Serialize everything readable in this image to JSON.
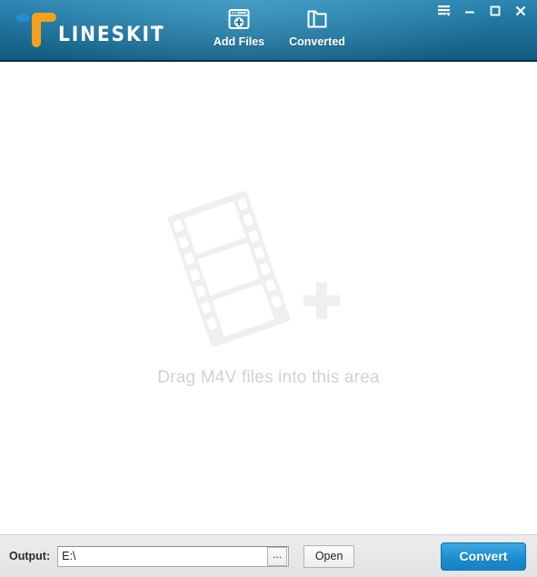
{
  "window": {
    "title": "LINESKIT",
    "controls": [
      {
        "name": "menu",
        "icon": "menu-lines-arrow-icon",
        "label": ""
      },
      {
        "name": "minimize",
        "icon": "minimize-icon",
        "label": ""
      },
      {
        "name": "maximize",
        "icon": "maximize-icon",
        "label": ""
      },
      {
        "name": "close",
        "icon": "close-icon",
        "label": ""
      }
    ]
  },
  "header": {
    "logo_text": "LINESKIT",
    "logo_mark_color": "#f5a01b",
    "logo_dot_color": "#1e8fd6",
    "background_top": "#2b86b2",
    "background_bottom": "#125a81",
    "toolbar": [
      {
        "id": "add-files",
        "label": "Add Files",
        "icon": "window-plus-icon"
      },
      {
        "id": "converted",
        "label": "Converted",
        "icon": "folder-icon"
      }
    ]
  },
  "main": {
    "drop_text": "Drag M4V files into this area",
    "drop_text_color": "#cfd2d4",
    "placeholder_graphic": "film-strip-plus-icon",
    "placeholder_graphic_color": "#efefef"
  },
  "footer": {
    "output_label": "Output:",
    "output_value": "E:\\",
    "output_placeholder": "",
    "browse_label": "...",
    "open_label": "Open",
    "convert_label": "Convert",
    "convert_color": "#1f8fd2"
  }
}
